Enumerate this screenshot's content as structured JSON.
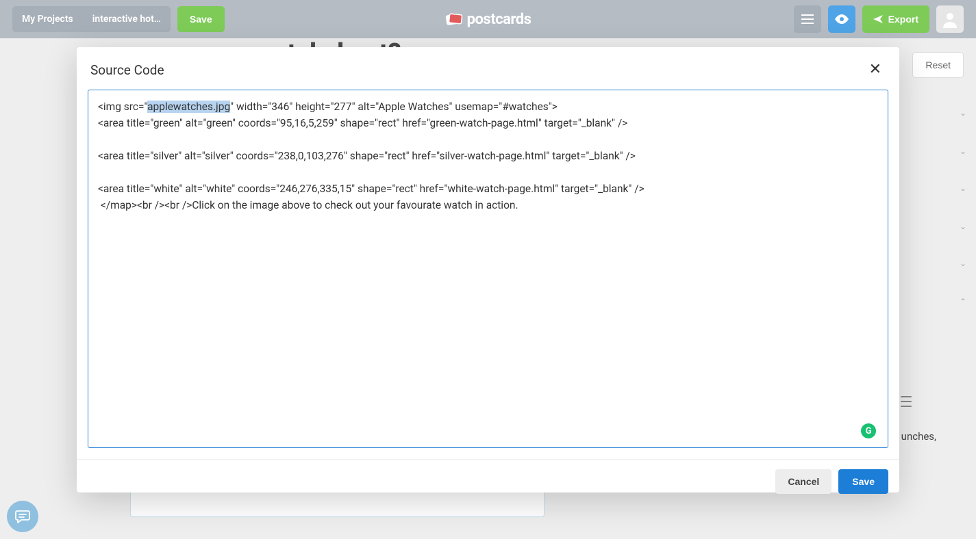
{
  "nav": {
    "projects_label": "My Projects",
    "crumb_label": "interactive hot…",
    "save_label": "Save",
    "logo_text": "postcards",
    "export_label": "Export"
  },
  "background": {
    "title_fragment": "style best?",
    "reset_label": "Reset",
    "snippet_text": "unches,"
  },
  "modal": {
    "title": "Source Code",
    "cancel_label": "Cancel",
    "save_label": "Save",
    "grammarly_badge": "G",
    "code_pre": "<img src=\"",
    "code_highlight": "applewatches.jpg",
    "code_post": "\" width=\"346\" height=\"277\" alt=\"Apple Watches\" usemap=\"#watches\">\n<area title=\"green\" alt=\"green\" coords=\"95,16,5,259\" shape=\"rect\" href=\"green-watch-page.html\" target=\"_blank\" />\n\n<area title=\"silver\" alt=\"silver\" coords=\"238,0,103,276\" shape=\"rect\" href=\"silver-watch-page.html\" target=\"_blank\" />\n\n<area title=\"white\" alt=\"white\" coords=\"246,276,335,15\" shape=\"rect\" href=\"white-watch-page.html\" target=\"_blank\" />\n </map><br /><br />Click on the image above to check out your favourate watch in action."
  }
}
